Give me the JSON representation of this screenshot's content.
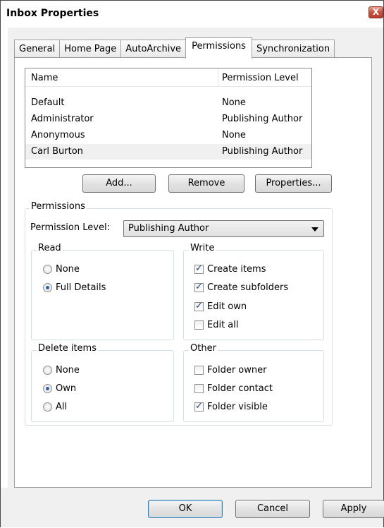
{
  "window": {
    "title": "Inbox Properties",
    "close_glyph": "X"
  },
  "tabs": [
    {
      "label": "General",
      "active": false
    },
    {
      "label": "Home Page",
      "active": false
    },
    {
      "label": "AutoArchive",
      "active": false
    },
    {
      "label": "Permissions",
      "active": true
    },
    {
      "label": "Synchronization",
      "active": false
    }
  ],
  "permissions_list": {
    "columns": [
      "Name",
      "Permission Level"
    ],
    "rows": [
      {
        "name": "Default",
        "level": "None"
      },
      {
        "name": "Administrator",
        "level": "Publishing Author"
      },
      {
        "name": "Anonymous",
        "level": "None"
      },
      {
        "name": "Carl Burton",
        "level": "Publishing Author",
        "selected": true
      }
    ]
  },
  "list_buttons": {
    "add": "Add...",
    "remove": "Remove",
    "properties": "Properties..."
  },
  "permissions_group": {
    "label": "Permissions",
    "level_label": "Permission Level:",
    "level_value": "Publishing Author"
  },
  "read_group": {
    "label": "Read",
    "options": [
      {
        "label": "None",
        "checked": false
      },
      {
        "label": "Full Details",
        "checked": true
      }
    ]
  },
  "write_group": {
    "label": "Write",
    "options": [
      {
        "label": "Create items",
        "checked": true
      },
      {
        "label": "Create subfolders",
        "checked": true
      },
      {
        "label": "Edit own",
        "checked": true
      },
      {
        "label": "Edit all",
        "checked": false
      }
    ]
  },
  "delete_group": {
    "label": "Delete items",
    "options": [
      {
        "label": "None",
        "checked": false
      },
      {
        "label": "Own",
        "checked": true
      },
      {
        "label": "All",
        "checked": false
      }
    ]
  },
  "other_group": {
    "label": "Other",
    "options": [
      {
        "label": "Folder owner",
        "checked": false
      },
      {
        "label": "Folder contact",
        "checked": false
      },
      {
        "label": "Folder visible",
        "checked": true
      }
    ]
  },
  "dialog_buttons": {
    "ok": "OK",
    "cancel": "Cancel",
    "apply": "Apply"
  }
}
